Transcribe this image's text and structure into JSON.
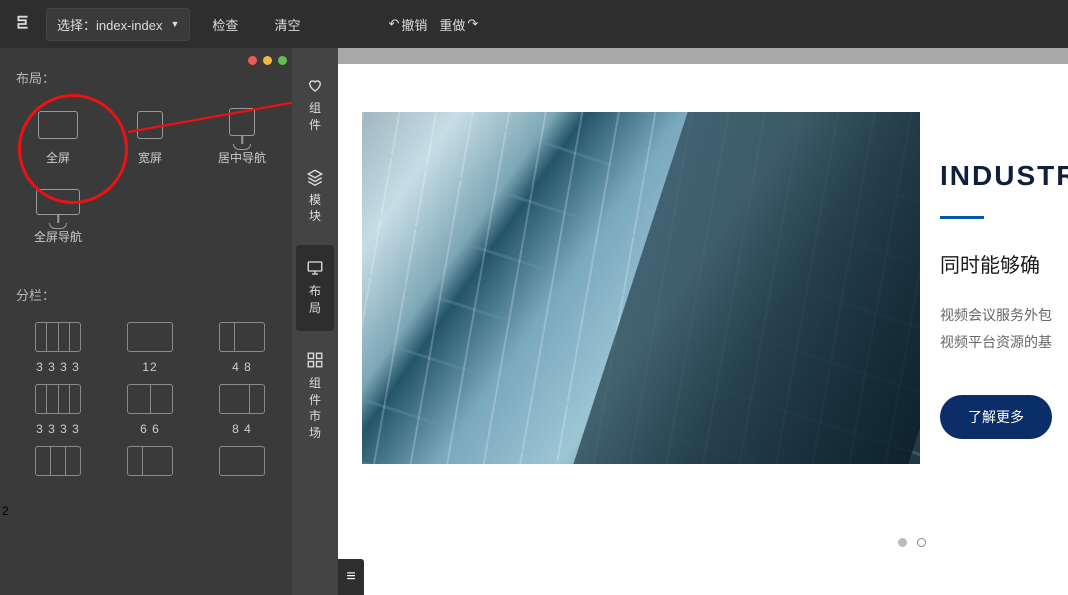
{
  "topbar": {
    "selector_label": "选择：index-index",
    "inspect": "检查",
    "clear": "清空",
    "undo": "撤销",
    "redo": "重做"
  },
  "left_panel": {
    "layout_label": "布局：",
    "layouts": [
      {
        "label": "全屏"
      },
      {
        "label": "宽屏"
      },
      {
        "label": "居中导航"
      },
      {
        "label": "全屏导航"
      }
    ],
    "columns_label": "分栏：",
    "columns": [
      {
        "label": "3 3 3 3",
        "cols": [
          1,
          1,
          1,
          1
        ]
      },
      {
        "label": "12",
        "cols": [
          1
        ]
      },
      {
        "label": "4 8",
        "cols": [
          1,
          2
        ]
      },
      {
        "label": "3 3 3 3",
        "cols": [
          1,
          1,
          1,
          1
        ]
      },
      {
        "label": "6 6",
        "cols": [
          1,
          1
        ]
      },
      {
        "label": "8 4",
        "cols": [
          2,
          1
        ]
      },
      {
        "label": "",
        "cols": [
          1,
          1,
          1
        ]
      },
      {
        "label": "",
        "cols": [
          1,
          2
        ]
      },
      {
        "label": "",
        "cols": [
          1
        ]
      }
    ]
  },
  "rail": {
    "components": "组件",
    "modules": "模块",
    "layout": "布局",
    "market": "组件市场"
  },
  "hero": {
    "heading": "INDUSTR",
    "subheading": "同时能够确",
    "body_line1": "视频会议服务外包",
    "body_line2": "视频平台资源的基",
    "cta": "了解更多"
  },
  "marker": "2"
}
